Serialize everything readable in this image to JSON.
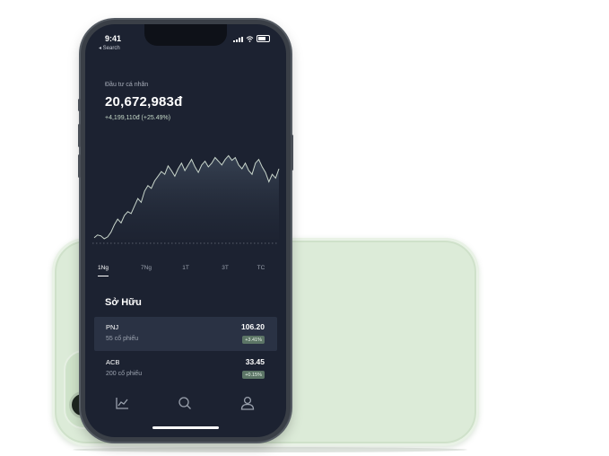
{
  "status_bar": {
    "time": "9:41",
    "back_label": "◂ Search"
  },
  "portfolio": {
    "account_label": "Đầu tư cá nhân",
    "balance": "20,672,983đ",
    "change": "+4,199,110đ (+25.49%)"
  },
  "chart_data": {
    "type": "area",
    "y_values": [
      2,
      5,
      4,
      1,
      3,
      8,
      16,
      22,
      18,
      26,
      30,
      28,
      36,
      44,
      40,
      52,
      58,
      55,
      63,
      68,
      73,
      70,
      79,
      74,
      68,
      76,
      82,
      74,
      80,
      86,
      78,
      72,
      80,
      84,
      78,
      82,
      88,
      84,
      80,
      86,
      90,
      85,
      88,
      80,
      76,
      82,
      74,
      70,
      82,
      86,
      78,
      72,
      62,
      70,
      66,
      76
    ],
    "ylim": [
      0,
      100
    ],
    "color": "#c9d6cc"
  },
  "range_tabs": [
    {
      "label": "1Ng",
      "active": true
    },
    {
      "label": "7Ng",
      "active": false
    },
    {
      "label": "1T",
      "active": false
    },
    {
      "label": "3T",
      "active": false
    },
    {
      "label": "TC",
      "active": false
    }
  ],
  "holdings": {
    "title": "Sở Hữu",
    "items": [
      {
        "symbol": "PNJ",
        "shares": "55 cổ phiếu",
        "price": "106.20",
        "change": "+3.41%",
        "selected": true
      },
      {
        "symbol": "ACB",
        "shares": "200 cổ phiếu",
        "price": "33.45",
        "change": "+0.15%",
        "selected": false
      }
    ]
  },
  "bottom_nav": [
    {
      "icon": "chart-icon"
    },
    {
      "icon": "search-icon"
    },
    {
      "icon": "profile-icon"
    }
  ],
  "colors": {
    "screen_bg": "#1c2231",
    "back_phone": "#dcebd8",
    "badge_bg": "#5c7566"
  }
}
